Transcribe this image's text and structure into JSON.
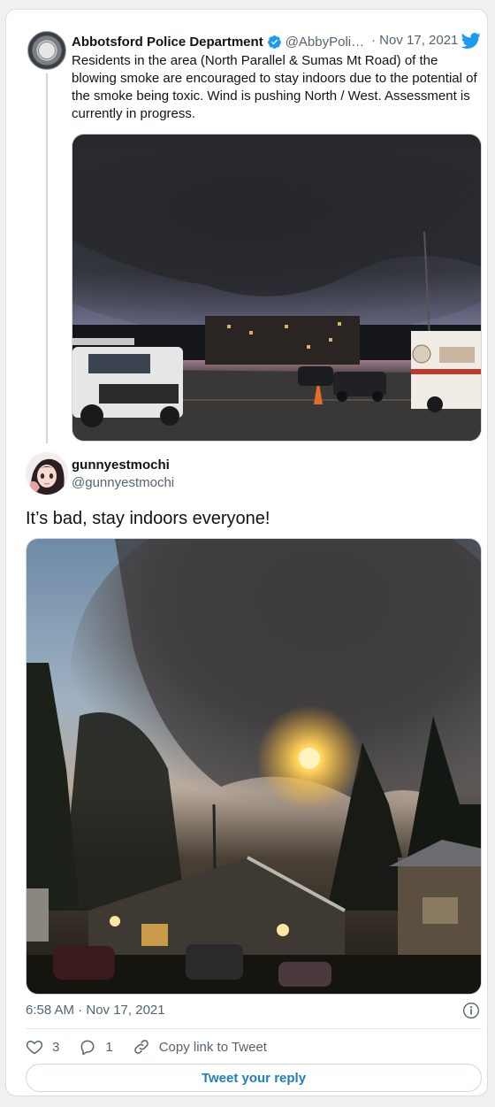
{
  "quoted_tweet": {
    "author_name": "Abbotsford Police Department",
    "author_handle": "@AbbyPoli…",
    "date": "· Nov 17, 2021",
    "text": "Residents in the area (North Parallel & Sumas Mt Road) of the blowing smoke are encouraged to stay indoors due to the potential of the smoke being toxic.  Wind is pushing North / West.  Assessment is currently in progress."
  },
  "main_tweet": {
    "author_name": "gunnyestmochi",
    "author_handle": "@gunnyestmochi",
    "text": "It’s bad, stay indoors everyone!",
    "timestamp": "6:58 AM · Nov 17, 2021"
  },
  "actions": {
    "likes": "3",
    "replies": "1",
    "copy_link_label": "Copy link to Tweet"
  },
  "reply_button_label": "Tweet your reply",
  "colors": {
    "twitter_blue": "#1d9bf0",
    "like_red": "#f91880",
    "text_secondary": "#536471"
  },
  "icons": [
    "verified-badge-icon",
    "twitter-bird-icon",
    "info-icon",
    "heart-icon",
    "reply-bubble-icon",
    "link-icon"
  ]
}
